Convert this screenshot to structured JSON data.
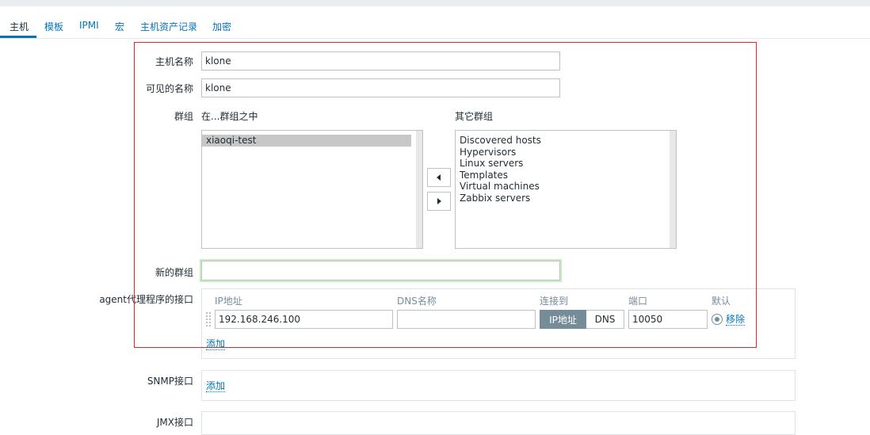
{
  "tabs": [
    {
      "label": "主机"
    },
    {
      "label": "模板"
    },
    {
      "label": "IPMI"
    },
    {
      "label": "宏"
    },
    {
      "label": "主机资产记录"
    },
    {
      "label": "加密"
    }
  ],
  "form": {
    "hostname_label": "主机名称",
    "hostname_value": "klone",
    "visible_name_label": "可见的名称",
    "visible_name_value": "klone",
    "groups_label": "群组",
    "in_groups_label": "在...群组之中",
    "other_groups_label": "其它群组",
    "in_groups": [
      "xiaoqi-test"
    ],
    "other_groups": [
      "Discovered hosts",
      "Hypervisors",
      "Linux servers",
      "Templates",
      "Virtual machines",
      "Zabbix servers"
    ],
    "new_group_label": "新的群组",
    "new_group_value": ""
  },
  "agent_interface": {
    "label": "agent代理程序的接口",
    "col_ip": "IP地址",
    "col_dns": "DNS名称",
    "col_connect": "连接到",
    "col_port": "端口",
    "col_default": "默认",
    "ip_value": "192.168.246.100",
    "dns_value": "",
    "connect_ip": "IP地址",
    "connect_dns": "DNS",
    "port_value": "10050",
    "remove_link": "移除",
    "add_link": "添加"
  },
  "snmp_interface": {
    "label": "SNMP接口",
    "add_link": "添加"
  },
  "jmx_interface": {
    "label": "JMX接口"
  },
  "colors": {
    "link": "#0275b8",
    "highlight_box": "#e8262c",
    "segment_active": "#768d99",
    "focus_border": "#a9d3a4"
  }
}
